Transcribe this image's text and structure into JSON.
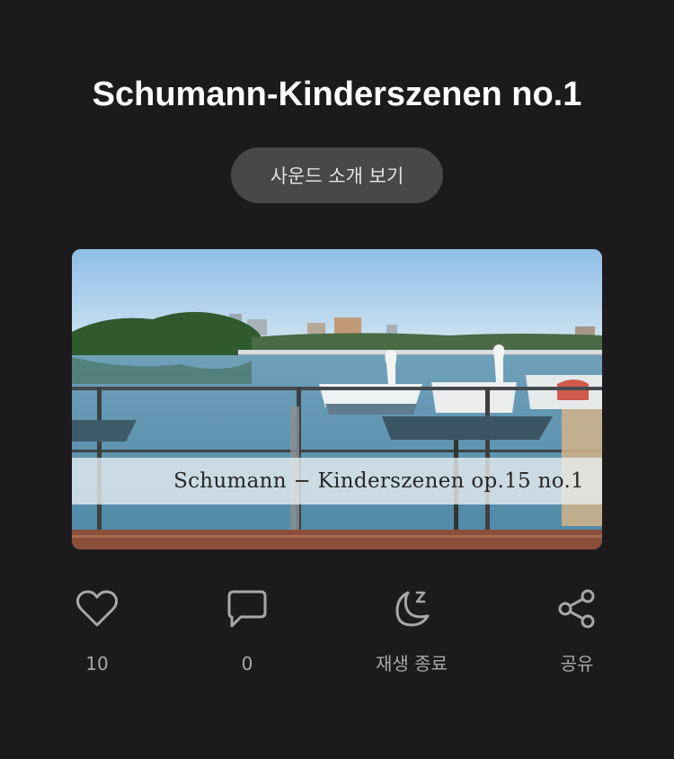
{
  "title": "Schumann-Kinderszenen no.1",
  "intro_button": "사운드 소개 보기",
  "thumbnail": {
    "caption": "Schumann − Kinderszenen op.15 no.1"
  },
  "actions": [
    {
      "icon": "heart-icon",
      "label": "10"
    },
    {
      "icon": "comment-icon",
      "label": "0"
    },
    {
      "icon": "sleep-timer-icon",
      "label": "재생 종료"
    },
    {
      "icon": "share-icon",
      "label": "공유"
    }
  ],
  "colors": {
    "background": "#1c1a1d",
    "button_bg": "#49474a",
    "icon": "#a9a7aa"
  }
}
